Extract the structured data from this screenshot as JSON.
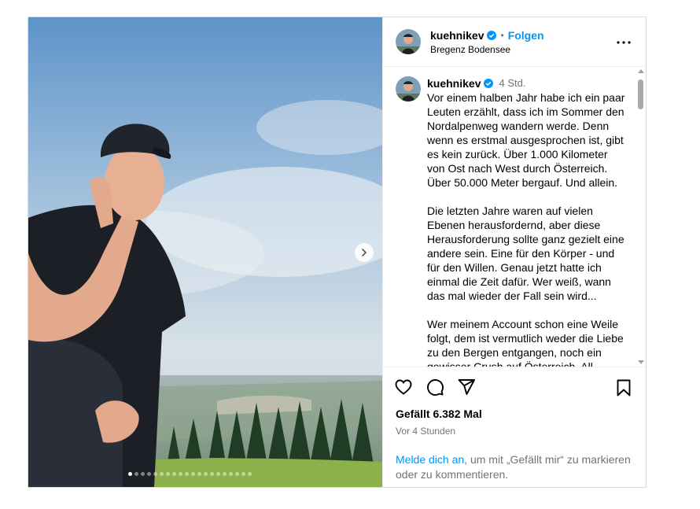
{
  "post": {
    "username": "kuehnikev",
    "follow_label": "Folgen",
    "separator": "•",
    "location": "Bregenz Bodensee",
    "caption_time": "4 Std.",
    "caption_paragraphs": [
      "Vor einem halben Jahr habe ich ein paar Leuten erzählt, dass ich im Sommer den Nordalpenweg wandern werde. Denn wenn es erstmal ausgesprochen ist, gibt es kein zurück. Über 1.000 Kilometer von Ost nach West durch Österreich. Über 50.000 Meter bergauf. Und allein.",
      "Die letzten Jahre waren auf vielen Ebenen herausfordernd, aber diese Herausforderung sollte ganz gezielt eine andere sein. Eine für den Körper - und für den Willen. Genau jetzt hatte ich einmal die Zeit dafür. Wer weiß, wann das mal wieder der Fall sein wird...",
      "Wer meinem Account schon eine Weile folgt, dem ist vermutlich weder die Liebe zu den Bergen entgangen, noch ein gewisser Crush auf Österreich. All"
    ],
    "likes": "Gefällt 6.382 Mal",
    "posted_ago": "Vor 4 Stunden",
    "login_link": "Melde dich an",
    "login_rest": ", um mit „Gefällt mir“ zu markieren oder zu kommentieren.",
    "carousel": {
      "total": 20,
      "active_index": 0
    }
  },
  "icons": {
    "verified": "verified-badge-icon",
    "more": "more-options-icon",
    "like": "heart-icon",
    "comment": "comment-icon",
    "share": "paper-plane-icon",
    "save": "bookmark-icon",
    "next": "chevron-right-icon"
  },
  "colors": {
    "accent": "#0095f6",
    "muted": "#737373",
    "border": "#dbdbdb"
  }
}
